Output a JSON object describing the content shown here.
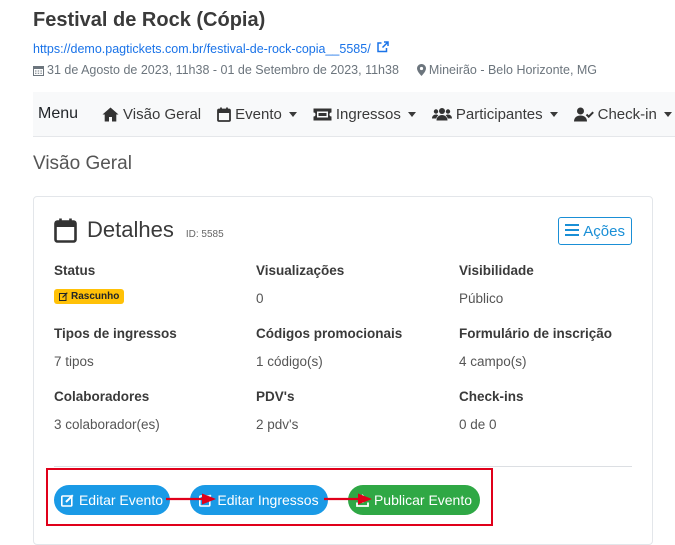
{
  "event": {
    "title": "Festival de Rock (Cópia)",
    "url": "https://demo.pagtickets.com.br/festival-de-rock-copia__5585/",
    "date": "31 de Agosto de 2023, 11h38 - 01 de Setembro de 2023, 11h38",
    "location": "Mineirão - Belo Horizonte, MG"
  },
  "nav": {
    "brand": "Menu",
    "items": [
      {
        "label": "Visão Geral",
        "icon": "home-icon",
        "dropdown": false
      },
      {
        "label": "Evento",
        "icon": "calendar-icon",
        "dropdown": true
      },
      {
        "label": "Ingressos",
        "icon": "ticket-icon",
        "dropdown": true
      },
      {
        "label": "Participantes",
        "icon": "users-icon",
        "dropdown": true
      },
      {
        "label": "Check-in",
        "icon": "user-check-icon",
        "dropdown": true
      }
    ]
  },
  "page_title": "Visão Geral",
  "card": {
    "title": "Detalhes",
    "id_label": "ID: 5585",
    "actions_label": "Ações",
    "fields": {
      "status": {
        "label": "Status",
        "value": "Rascunho"
      },
      "visualizacoes": {
        "label": "Visualizações",
        "value": "0"
      },
      "visibilidade": {
        "label": "Visibilidade",
        "value": "Público"
      },
      "tipos": {
        "label": "Tipos de ingressos",
        "value": "7 tipos"
      },
      "codigos": {
        "label": "Códigos promocionais",
        "value": "1 código(s)"
      },
      "formulario": {
        "label": "Formulário de inscrição",
        "value": "4 campo(s)"
      },
      "colaboradores": {
        "label": "Colaboradores",
        "value": "3 colaborador(es)"
      },
      "pdvs": {
        "label": "PDV's",
        "value": "2 pdv's"
      },
      "checkins": {
        "label": "Check-ins",
        "value": "0 de 0"
      }
    },
    "buttons": {
      "edit_event": "Editar Evento",
      "edit_tickets": "Editar Ingressos",
      "publish": "Publicar Evento"
    }
  },
  "colors": {
    "accent": "#1a9ae6",
    "success": "#2fa845",
    "warning": "#ffc107",
    "highlight": "#e0001a"
  }
}
